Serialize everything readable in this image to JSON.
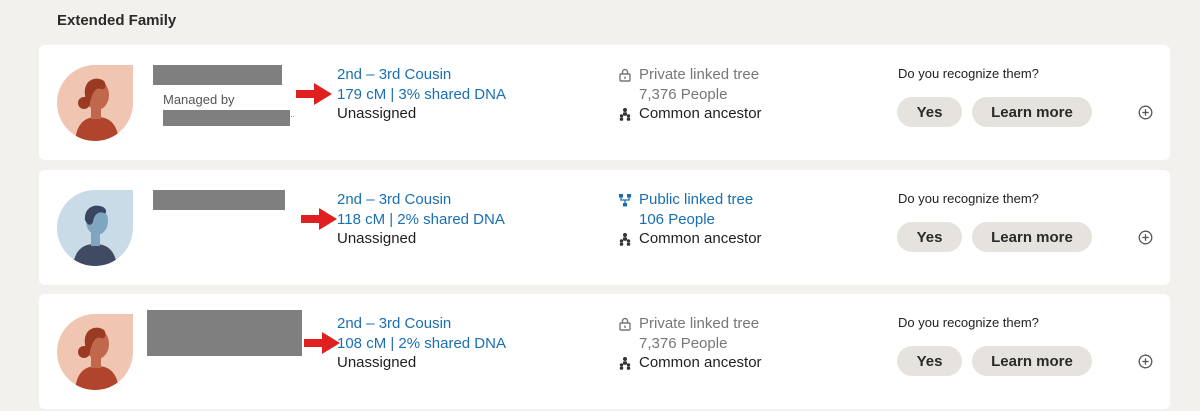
{
  "section": {
    "title": "Extended Family"
  },
  "matches": [
    {
      "avatar": "female-avatar-icon",
      "managed_by_label": "Managed by",
      "trailing": "..",
      "relationship": "2nd – 3rd Cousin",
      "dna": "179 cM | 3% shared DNA",
      "assignment": "Unassigned",
      "tree_type": "Private linked tree",
      "tree_people": "7,376 People",
      "common_ancestor": "Common ancestor",
      "question": "Do you recognize them?",
      "yes_label": "Yes",
      "learn_label": "Learn more"
    },
    {
      "avatar": "male-avatar-icon",
      "relationship": "2nd – 3rd Cousin",
      "dna": "118 cM | 2% shared DNA",
      "assignment": "Unassigned",
      "tree_type": "Public linked tree",
      "tree_people": "106 People",
      "common_ancestor": "Common ancestor",
      "question": "Do you recognize them?",
      "yes_label": "Yes",
      "learn_label": "Learn more"
    },
    {
      "avatar": "female-avatar-icon",
      "relationship": "2nd – 3rd Cousin",
      "dna": "108 cM | 2% shared DNA",
      "assignment": "Unassigned",
      "tree_type": "Private linked tree",
      "tree_people": "7,376 People",
      "common_ancestor": "Common ancestor",
      "question": "Do you recognize them?",
      "yes_label": "Yes",
      "learn_label": "Learn more"
    }
  ],
  "colors": {
    "background": "#f3f1ee",
    "link": "#1a6fb3",
    "arrow": "#e02020",
    "button": "#e6e3de",
    "redaction": "#7f7f7f"
  }
}
